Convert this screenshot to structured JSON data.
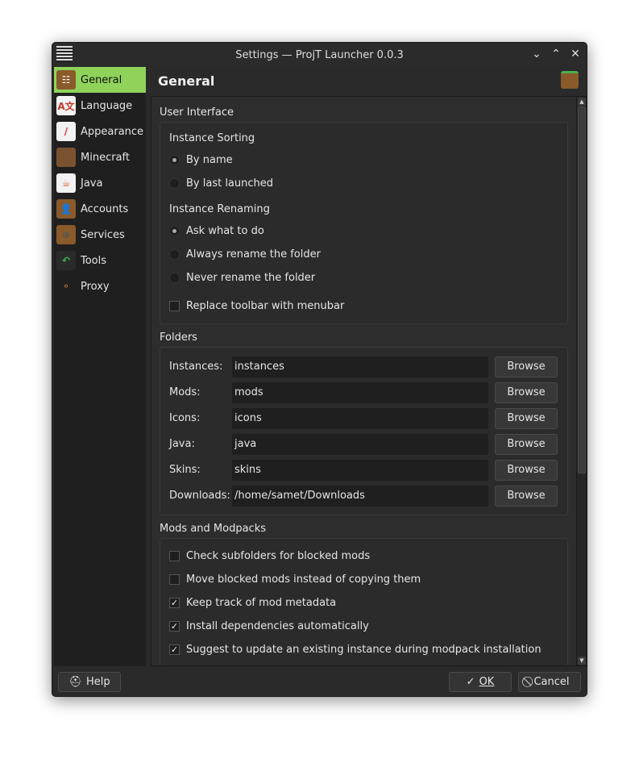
{
  "window": {
    "title": "Settings — ProjT Launcher 0.0.3"
  },
  "sidebar": {
    "items": [
      {
        "label": "General",
        "glyph": "☷",
        "bg": "#8a5a2b",
        "fg": "#fff"
      },
      {
        "label": "Language",
        "glyph": "A文",
        "bg": "#f2f2f2",
        "fg": "#c0392b"
      },
      {
        "label": "Appearance",
        "glyph": "/",
        "bg": "#f2f2f2",
        "fg": "#d32f2f"
      },
      {
        "label": "Minecraft",
        "glyph": "",
        "bg": "#7a5230",
        "fg": "#fff"
      },
      {
        "label": "Java",
        "glyph": "☕",
        "bg": "#f2f2f2",
        "fg": "#e0632b"
      },
      {
        "label": "Accounts",
        "glyph": "👤",
        "bg": "#8a5a2b",
        "fg": "#eee"
      },
      {
        "label": "Services",
        "glyph": "⊕",
        "bg": "#8a5a2b",
        "fg": "#555"
      },
      {
        "label": "Tools",
        "glyph": "↶",
        "bg": "#2a2a2a",
        "fg": "#3bb54a"
      },
      {
        "label": "Proxy",
        "glyph": "⚬",
        "bg": "#1f1f1f",
        "fg": "#c07a3a"
      }
    ]
  },
  "page": {
    "title": "General"
  },
  "ui": {
    "group": "User Interface",
    "sorting_label": "Instance Sorting",
    "by_name": "By name",
    "by_last": "By last launched",
    "renaming_label": "Instance Renaming",
    "ask": "Ask what to do",
    "always": "Always rename the folder",
    "never": "Never rename the folder",
    "menubar": "Replace toolbar with menubar"
  },
  "folders": {
    "group": "Folders",
    "browse": "Browse",
    "rows": [
      {
        "label": "Instances:",
        "value": "instances"
      },
      {
        "label": "Mods:",
        "value": "mods"
      },
      {
        "label": "Icons:",
        "value": "icons"
      },
      {
        "label": "Java:",
        "value": "java"
      },
      {
        "label": "Skins:",
        "value": "skins"
      },
      {
        "label": "Downloads:",
        "value": "/home/samet/Downloads"
      }
    ]
  },
  "mods": {
    "group": "Mods and Modpacks",
    "items": [
      {
        "label": "Check subfolders for blocked mods",
        "checked": false
      },
      {
        "label": "Move blocked mods instead of copying them",
        "checked": false
      },
      {
        "label": "Keep track of mod metadata",
        "checked": true
      },
      {
        "label": "Install dependencies automatically",
        "checked": true
      },
      {
        "label": "Suggest to update an existing instance during modpack installation",
        "checked": true
      }
    ]
  },
  "buttons": {
    "help": "Help",
    "ok": "OK",
    "cancel": "Cancel"
  }
}
